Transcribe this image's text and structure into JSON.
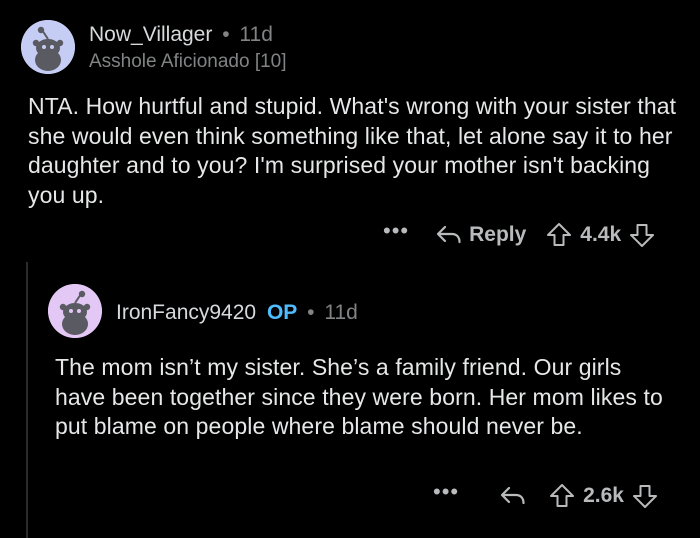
{
  "comments": [
    {
      "username": "Now_Villager",
      "separator": "•",
      "age": "11d",
      "flair": "Asshole Aficionado [10]",
      "avatar_icon": "snoo-avatar-icon",
      "avatar_color": "#c6cdf5",
      "body": "NTA. How hurtful and stupid. What's wrong with your sister that she would even think something like that, let alone say it to her daughter and to you? I'm surprised your mother isn't backing you up.",
      "actions": {
        "more": "•••",
        "reply_label": "Reply",
        "score": "4.4k"
      }
    },
    {
      "username": "IronFancy9420",
      "op_badge": "OP",
      "separator": "•",
      "age": "11d",
      "avatar_icon": "snoo-avatar-icon",
      "avatar_color": "#e3c7f5",
      "body": "The mom isn’t my sister. She’s a family friend. Our girls have been together since they were born. Her mom likes to put blame on people where blame should never be.",
      "actions": {
        "more": "•••",
        "score": "2.6k"
      }
    }
  ]
}
